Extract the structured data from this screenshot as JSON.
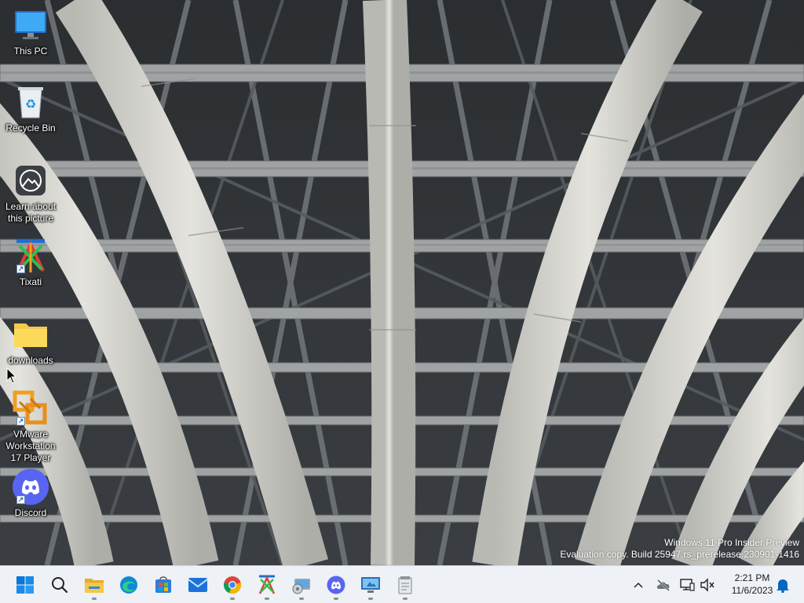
{
  "desktop": {
    "icons": [
      {
        "label": "This PC",
        "icon": "computer-icon"
      },
      {
        "label": "Recycle Bin",
        "icon": "recycle-bin-icon"
      },
      {
        "label": "Learn about this picture",
        "icon": "learn-picture-icon"
      },
      {
        "label": "Tixati",
        "icon": "tixati-icon"
      },
      {
        "label": "downloads",
        "icon": "folder-icon"
      },
      {
        "label": "VMware Workstation 17 Player",
        "icon": "vmware-icon"
      },
      {
        "label": "Discord",
        "icon": "discord-icon"
      }
    ]
  },
  "watermark": {
    "line1": "Windows 11 Pro Insider Preview",
    "line2": "Evaluation copy. Build 25947.rs_prerelease.230901-1416"
  },
  "taskbar": {
    "items": [
      {
        "name": "start",
        "icon": "windows-start-icon"
      },
      {
        "name": "search",
        "icon": "search-icon"
      },
      {
        "name": "file-explorer",
        "icon": "file-explorer-icon"
      },
      {
        "name": "edge",
        "icon": "edge-icon"
      },
      {
        "name": "microsoft-store",
        "icon": "store-icon"
      },
      {
        "name": "mail",
        "icon": "mail-icon"
      },
      {
        "name": "chrome",
        "icon": "chrome-icon"
      },
      {
        "name": "tixati",
        "icon": "tixati-icon"
      },
      {
        "name": "disk-cleanup",
        "icon": "disk-cleanup-icon"
      },
      {
        "name": "discord",
        "icon": "discord-icon"
      },
      {
        "name": "remote-desktop",
        "icon": "remote-desktop-icon"
      },
      {
        "name": "notepad",
        "icon": "notepad-icon"
      }
    ],
    "tray": {
      "chevron": "chevron-up-icon",
      "onedrive": "onedrive-off-icon",
      "network": "network-icon",
      "volume": "volume-muted-icon",
      "time": "2:21 PM",
      "date": "11/6/2023",
      "notifications": "notification-bell-icon"
    },
    "accent": "#0067c0"
  }
}
